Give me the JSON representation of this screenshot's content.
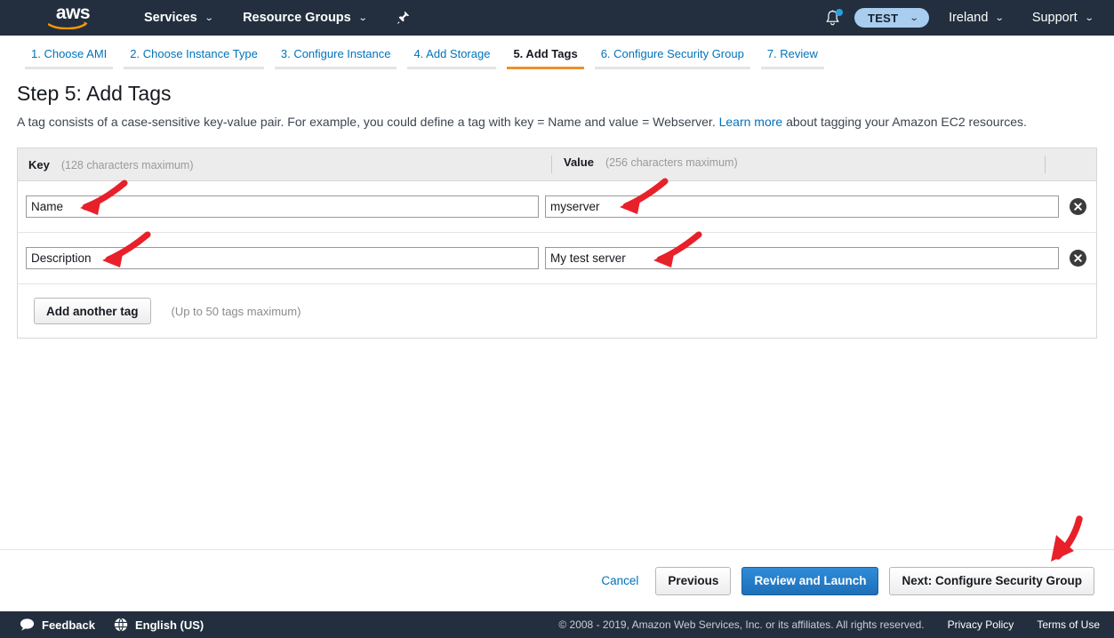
{
  "topnav": {
    "logo_text": "aws",
    "logo_name": "aws-logo",
    "items": [
      {
        "label": "Services",
        "caret": "⌄"
      },
      {
        "label": "Resource Groups",
        "caret": "⌄"
      }
    ],
    "pin_icon": "pushpin-icon",
    "bell_icon": "notifications-bell-icon",
    "account_label": "TEST",
    "account_caret": "⌄",
    "region_label": "Ireland",
    "region_caret": "⌄",
    "support_label": "Support",
    "support_caret": "⌄"
  },
  "steps": [
    {
      "label": "1. Choose AMI",
      "active": false
    },
    {
      "label": "2. Choose Instance Type",
      "active": false
    },
    {
      "label": "3. Configure Instance",
      "active": false
    },
    {
      "label": "4. Add Storage",
      "active": false
    },
    {
      "label": "5. Add Tags",
      "active": true
    },
    {
      "label": "6. Configure Security Group",
      "active": false
    },
    {
      "label": "7. Review",
      "active": false
    }
  ],
  "page": {
    "title": "Step 5: Add Tags",
    "desc_before": "A tag consists of a case-sensitive key-value pair. For example, you could define a tag with key = Name and value = Webserver. ",
    "desc_link": "Learn more",
    "desc_after": " about tagging your Amazon EC2 resources."
  },
  "table": {
    "key_header": "Key",
    "key_hint": "(128 characters maximum)",
    "value_header": "Value",
    "value_hint": "(256 characters maximum)",
    "rows": [
      {
        "key": "Name",
        "value": "myserver",
        "delete_icon": "delete-circle-icon"
      },
      {
        "key": "Description",
        "value": "My test server",
        "delete_icon": "delete-circle-icon"
      }
    ],
    "add_button": "Add another tag",
    "add_hint": "(Up to 50 tags maximum)"
  },
  "actions": {
    "cancel": "Cancel",
    "previous": "Previous",
    "review_and_launch": "Review and Launch",
    "next": "Next: Configure Security Group"
  },
  "footer": {
    "feedback_label": "Feedback",
    "feedback_icon": "speech-bubble-icon",
    "language_label": "English (US)",
    "language_icon": "globe-icon",
    "copyright": "© 2008 - 2019, Amazon Web Services, Inc. or its affiliates. All rights reserved.",
    "privacy_policy": "Privacy Policy",
    "terms_of_use": "Terms of Use"
  },
  "annotations": {
    "color": "#e8202a",
    "arrows": [
      {
        "name": "arrow-to-key-field-1"
      },
      {
        "name": "arrow-to-value-field-1"
      },
      {
        "name": "arrow-to-key-field-2"
      },
      {
        "name": "arrow-to-value-field-2"
      },
      {
        "name": "arrow-to-next-button"
      }
    ]
  }
}
